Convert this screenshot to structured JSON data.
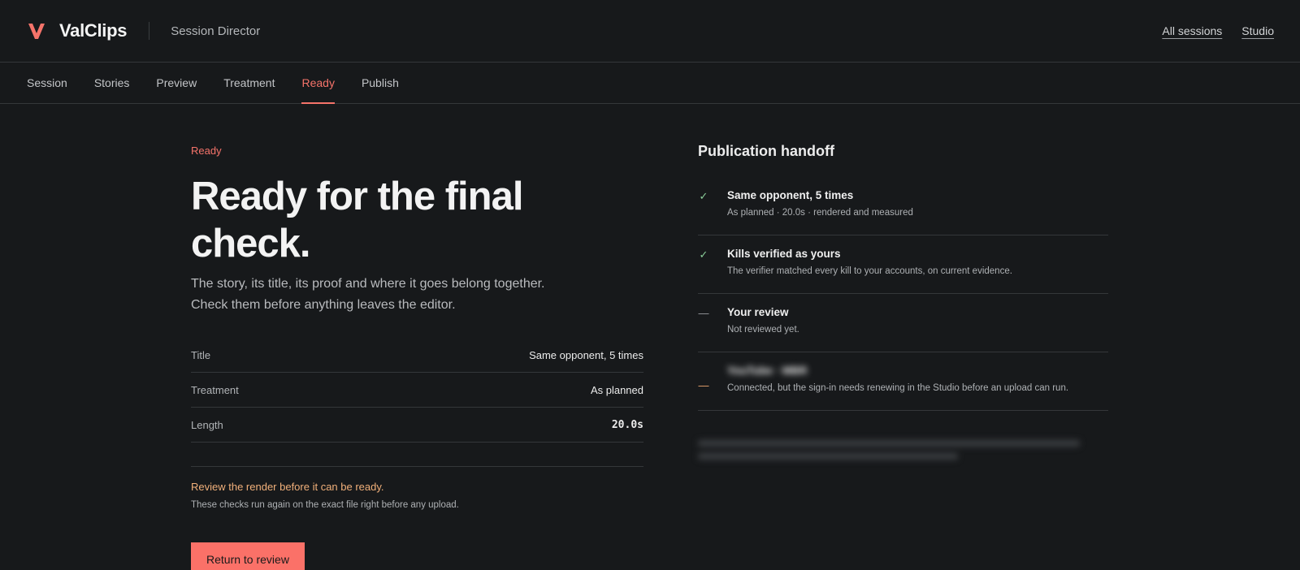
{
  "header": {
    "brand": "ValClips",
    "app_name": "Session Director",
    "links": [
      "All sessions",
      "Studio"
    ]
  },
  "tabs": [
    {
      "label": "Session",
      "active": false
    },
    {
      "label": "Stories",
      "active": false
    },
    {
      "label": "Preview",
      "active": false
    },
    {
      "label": "Treatment",
      "active": false
    },
    {
      "label": "Ready",
      "active": true
    },
    {
      "label": "Publish",
      "active": false
    }
  ],
  "main": {
    "eyebrow": "Ready",
    "headline": "Ready for the final check.",
    "lede_line1": "The story, its title, its proof and where it goes belong together.",
    "lede_line2": "Check them before anything leaves the editor.",
    "facts": [
      {
        "key": "Title",
        "value": "Same opponent, 5 times"
      },
      {
        "key": "Treatment",
        "value": "As planned"
      },
      {
        "key": "Length",
        "value": "20.0s"
      }
    ],
    "warning": "Review the render before it can be ready.",
    "note": "These checks run again on the exact file right before any upload.",
    "button_label": "Return to review"
  },
  "handoff": {
    "title": "Publication handoff",
    "checks": [
      {
        "status": "ok",
        "icon": "check-icon",
        "title": "Same opponent, 5 times",
        "detail": "As planned · 20.0s · rendered and measured"
      },
      {
        "status": "ok",
        "icon": "check-icon",
        "title": "Kills verified as yours",
        "detail": "The verifier matched every kill to your accounts, on current evidence."
      },
      {
        "status": "pending",
        "icon": "dash-icon",
        "title": "Your review",
        "detail": "Not reviewed yet."
      },
      {
        "status": "warn",
        "icon": "dash-icon",
        "title": "YouTube · MBR",
        "detail": "Connected, but the sign-in needs renewing in the Studio before an upload can run."
      }
    ]
  },
  "colors": {
    "accent": "#f5736a",
    "background": "#17191b",
    "warning": "#f1b07a",
    "ok": "#8bcf9a"
  }
}
